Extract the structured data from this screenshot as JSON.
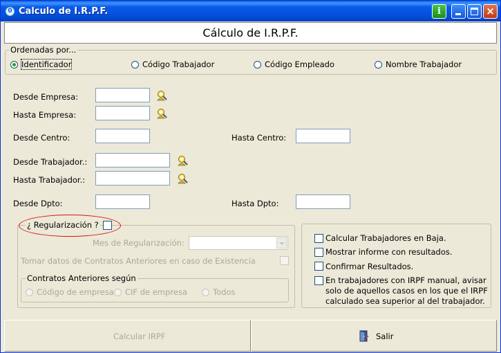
{
  "window": {
    "title": "Calculo de I.R.P.F.",
    "app_icon_glyph": "0",
    "info_button_label": "i",
    "close_button_label": "×"
  },
  "header": {
    "title": "Cálculo de I.R.P.F."
  },
  "order": {
    "label": "Ordenadas por...",
    "options": [
      {
        "label": "Identificador",
        "checked": true
      },
      {
        "label": "Código Trabajador",
        "checked": false
      },
      {
        "label": "Código Empleado",
        "checked": false
      },
      {
        "label": "Nombre Trabajador",
        "checked": false
      }
    ]
  },
  "filters": {
    "desde_empresa": {
      "label": "Desde Empresa:",
      "value": ""
    },
    "hasta_empresa": {
      "label": "Hasta Empresa:",
      "value": ""
    },
    "desde_centro": {
      "label": "Desde Centro:",
      "value": ""
    },
    "hasta_centro": {
      "label": "Hasta Centro:",
      "value": ""
    },
    "desde_trabajador": {
      "label": "Desde Trabajador.:",
      "value": ""
    },
    "hasta_trabajador": {
      "label": "Hasta Trabajador.:",
      "value": ""
    },
    "desde_dpto": {
      "label": "Desde Dpto:",
      "value": ""
    },
    "hasta_dpto": {
      "label": "Hasta Dpto:",
      "value": ""
    }
  },
  "regularizacion": {
    "label": "¿ Regularización ?",
    "checked": false,
    "mes_label": "Mes de Regularización:",
    "mes_value": "",
    "tomar_datos_label": "Tomar datos de Contratos Anteriores en caso de Existencia",
    "contratos_group_label": "Contratos Anteriores según",
    "contratos_options": [
      {
        "label": "Código de empresa"
      },
      {
        "label": "CIF de empresa"
      },
      {
        "label": "Todos"
      }
    ]
  },
  "options": [
    {
      "label": "Calcular Trabajadores en Baja.",
      "checked": false
    },
    {
      "label": "Mostrar informe con resultados.",
      "checked": false
    },
    {
      "label": "Confirmar Resultados.",
      "checked": false
    },
    {
      "label": "En trabajadores con IRPF manual, avisar solo de aquellos casos en los que el IRPF calculado sea superior al del trabajador.",
      "lines": [
        "En trabajadores con IRPF manual, avisar",
        "solo de aquellos casos en los que el IRPF",
        "calculado sea superior al del trabajador."
      ],
      "checked": false
    }
  ],
  "buttons": {
    "calcular": "Calcular IRPF",
    "salir": "Salir"
  },
  "colors": {
    "titlebar": "#0a5ae8",
    "face": "#ece9d8",
    "highlight_ellipse": "#d81010"
  }
}
